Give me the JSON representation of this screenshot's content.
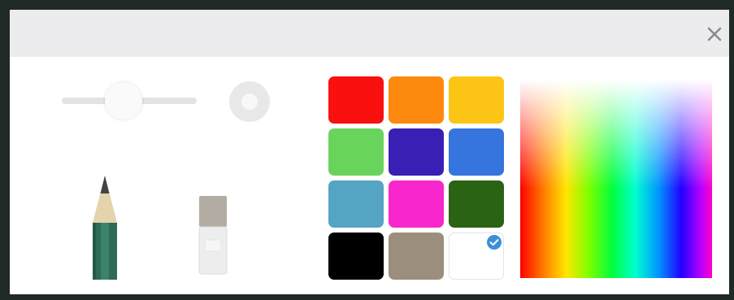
{
  "dialog": {
    "close_icon": "close-icon"
  },
  "brush": {
    "size_slider_level": 0.46,
    "tools": [
      {
        "id": "pencil",
        "icon": "pencil-icon"
      },
      {
        "id": "eraser",
        "icon": "eraser-icon"
      }
    ]
  },
  "palette": {
    "swatches": [
      {
        "name": "red",
        "color": "#fb1010",
        "selected": false
      },
      {
        "name": "orange",
        "color": "#fd8a0e",
        "selected": false
      },
      {
        "name": "yellow",
        "color": "#fcc515",
        "selected": false
      },
      {
        "name": "green",
        "color": "#69d45c",
        "selected": false
      },
      {
        "name": "indigo",
        "color": "#3a1fb5",
        "selected": false
      },
      {
        "name": "blue",
        "color": "#3575dd",
        "selected": false
      },
      {
        "name": "teal",
        "color": "#55a4c4",
        "selected": false
      },
      {
        "name": "magenta",
        "color": "#f726cd",
        "selected": false
      },
      {
        "name": "dark-green",
        "color": "#2b6314",
        "selected": false
      },
      {
        "name": "black",
        "color": "#000000",
        "selected": false
      },
      {
        "name": "taupe",
        "color": "#9c8e7c",
        "selected": false
      },
      {
        "name": "white",
        "color": "#ffffff",
        "selected": true
      }
    ],
    "check_icon": "check-icon",
    "accent": "#3b8fd6"
  },
  "spectrum": {
    "icon": "color-spectrum-picker"
  }
}
